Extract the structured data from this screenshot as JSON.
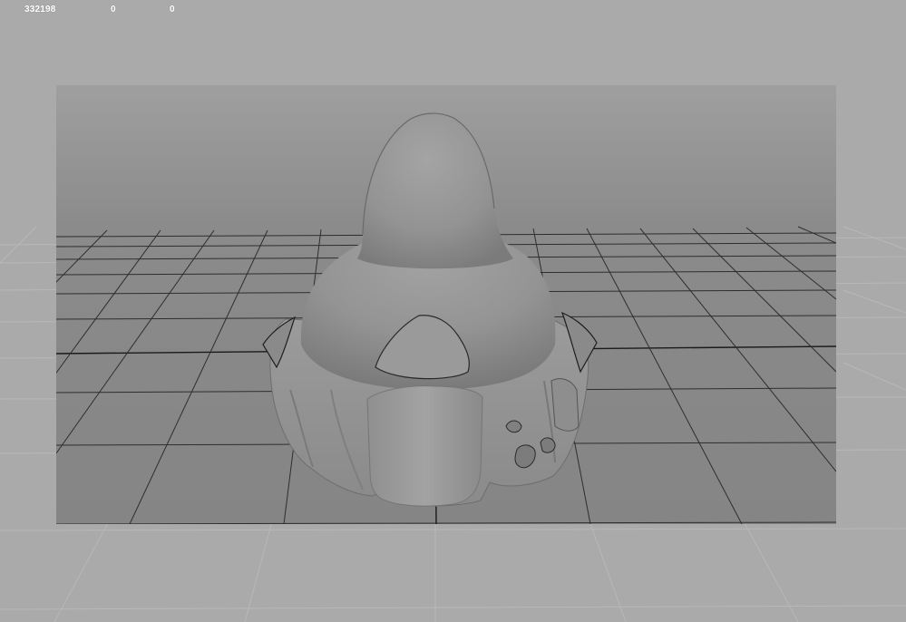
{
  "viewport": {
    "hud_stats": [
      "332198",
      "0",
      "0"
    ]
  },
  "colors": {
    "outer_background": "#aaaaaa",
    "gate_background_top": "#9a9a9a",
    "gate_background_bottom": "#8a8a8a",
    "grid_line": "#2a2a2a",
    "mesh_shade": "#8c8c8c",
    "mesh_highlight": "#a8a8a8"
  },
  "scene": {
    "object": "sculpted-mesh",
    "grid": "on",
    "resolution_gate": "on"
  }
}
